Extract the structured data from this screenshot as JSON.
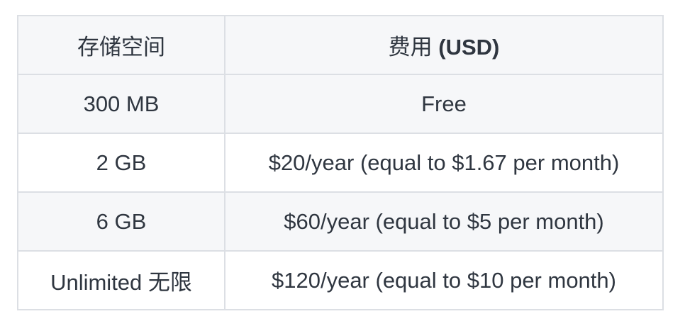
{
  "table": {
    "headers": {
      "storage": "存储空间",
      "price_prefix": "费用",
      "price_unit": "(USD)"
    },
    "rows": [
      {
        "storage": "300 MB",
        "price": "Free"
      },
      {
        "storage": "2 GB",
        "price": "$20/year (equal to $1.67 per month)"
      },
      {
        "storage": "6 GB",
        "price": "$60/year (equal to $5 per month)"
      },
      {
        "storage": "Unlimited 无限",
        "price": "$120/year (equal to $10 per month)"
      }
    ]
  }
}
